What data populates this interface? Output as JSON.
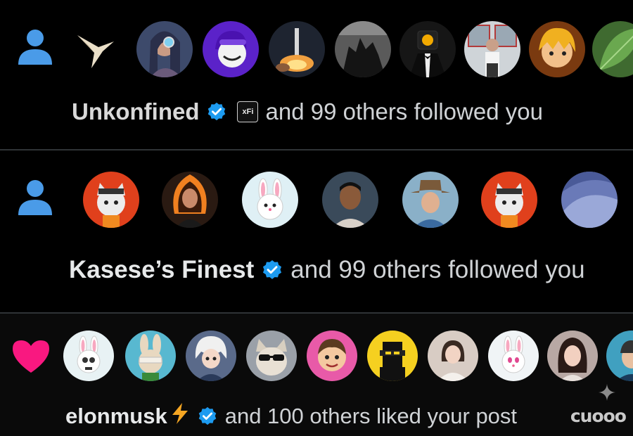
{
  "colors": {
    "background": "#000000",
    "divider": "#2f3336",
    "verified": "#1d9bf0",
    "follow_icon": "#4a9be8",
    "like_icon": "#f91880",
    "text": "#e7e9ea"
  },
  "notifications": [
    {
      "kind": "follow",
      "icon": "person-icon",
      "actor": "Unkonfined",
      "verified": true,
      "affiliate_badge": "xFi",
      "text": "and 99 others followed you",
      "avatar_count": 9
    },
    {
      "kind": "follow",
      "icon": "person-icon",
      "actor": "Kasese’s Finest",
      "verified": true,
      "text": "and 99 others followed you",
      "avatar_count": 7
    },
    {
      "kind": "like",
      "icon": "heart-icon",
      "actor": "elonmusk",
      "actor_emoji": "lightning-bolt-icon",
      "verified": true,
      "text": "and 100 others liked your post",
      "avatar_count": 10
    }
  ],
  "watermark": "cuooo"
}
